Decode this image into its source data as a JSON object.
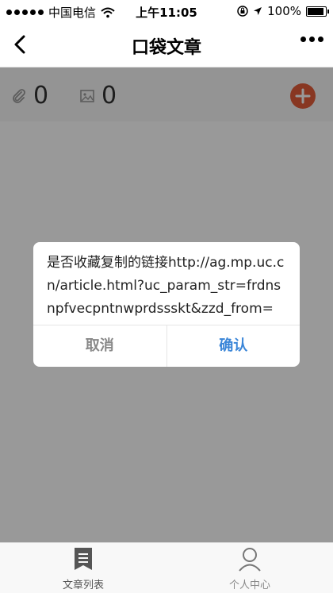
{
  "status_bar": {
    "carrier": "中国电信",
    "time": "上午11:05",
    "battery": "100%",
    "battery_level": 1.0
  },
  "nav": {
    "title": "口袋文章"
  },
  "stats": {
    "attachments_count": "0",
    "images_count": "0"
  },
  "dialog": {
    "message": "是否收藏复制的链接http://ag.mp.uc.cn/article.html?uc_param_str=frdnsnpfvecpntnwprdssskt&zzd_from=",
    "cancel_label": "取消",
    "confirm_label": "确认"
  },
  "tabbar": {
    "items": [
      {
        "label": "文章列表",
        "icon": "bookmark-icon"
      },
      {
        "label": "个人中心",
        "icon": "person-icon"
      }
    ]
  },
  "colors": {
    "accent": "#e35d3a",
    "confirm": "#3b86d8"
  }
}
